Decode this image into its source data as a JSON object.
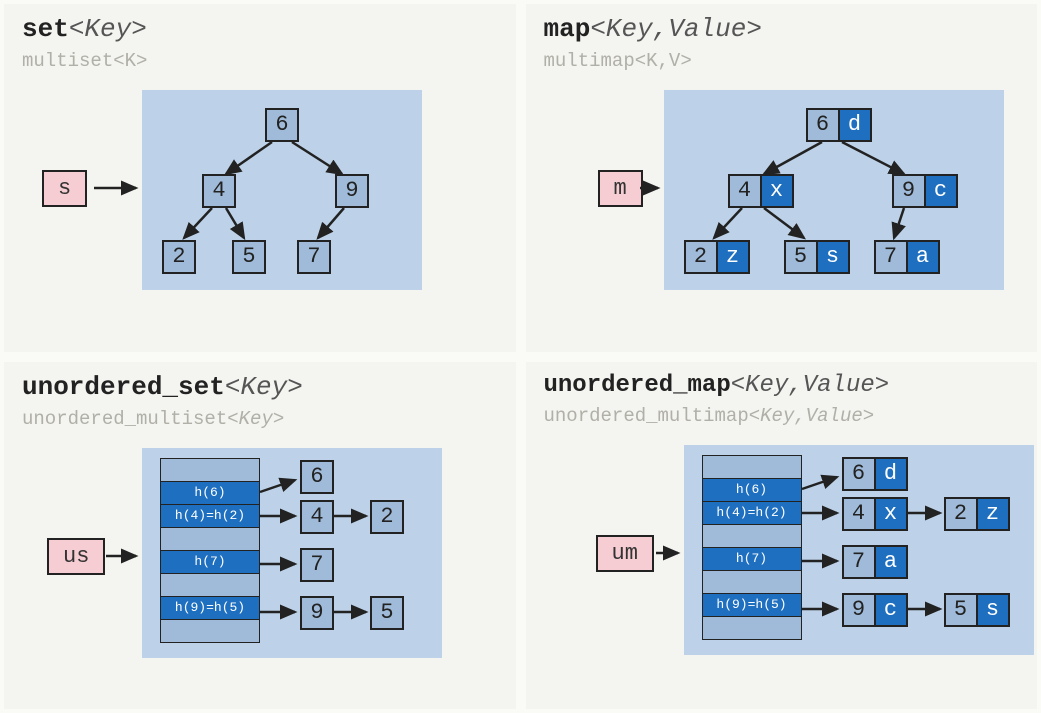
{
  "panels": {
    "set": {
      "title_bold": "set",
      "title_params": "<Key>",
      "subtitle": "multiset<K>",
      "var": "s",
      "nodes": {
        "n6": "6",
        "n4": "4",
        "n9": "9",
        "n2": "2",
        "n5": "5",
        "n7": "7"
      }
    },
    "map": {
      "title_bold": "map",
      "title_params": "<Key,Value>",
      "subtitle": "multimap<K,V>",
      "var": "m",
      "nodes": {
        "n6": {
          "k": "6",
          "v": "d"
        },
        "n4": {
          "k": "4",
          "v": "x"
        },
        "n9": {
          "k": "9",
          "v": "c"
        },
        "n2": {
          "k": "2",
          "v": "z"
        },
        "n5": {
          "k": "5",
          "v": "s"
        },
        "n7": {
          "k": "7",
          "v": "a"
        }
      }
    },
    "uset": {
      "title_bold": "unordered_set",
      "title_params": "<Key>",
      "subtitle_plain": "unordered_multiset",
      "subtitle_param": "<Key>",
      "var": "us",
      "hash": {
        "h6": "h(6)",
        "h42": "h(4)=h(2)",
        "h7": "h(7)",
        "h95": "h(9)=h(5)"
      },
      "nodes": {
        "n6": "6",
        "n4": "4",
        "n2": "2",
        "n7": "7",
        "n9": "9",
        "n5": "5"
      }
    },
    "umap": {
      "title_bold": "unordered_map",
      "title_params": "<Key,Value>",
      "subtitle_plain": "unordered_multimap",
      "subtitle_param": "<Key,Value>",
      "var": "um",
      "hash": {
        "h6": "h(6)",
        "h42": "h(4)=h(2)",
        "h7": "h(7)",
        "h95": "h(9)=h(5)"
      },
      "nodes": {
        "n6": {
          "k": "6",
          "v": "d"
        },
        "n4": {
          "k": "4",
          "v": "x"
        },
        "n2": {
          "k": "2",
          "v": "z"
        },
        "n7": {
          "k": "7",
          "v": "a"
        },
        "n9": {
          "k": "9",
          "v": "c"
        },
        "n5": {
          "k": "5",
          "v": "s"
        }
      }
    }
  }
}
